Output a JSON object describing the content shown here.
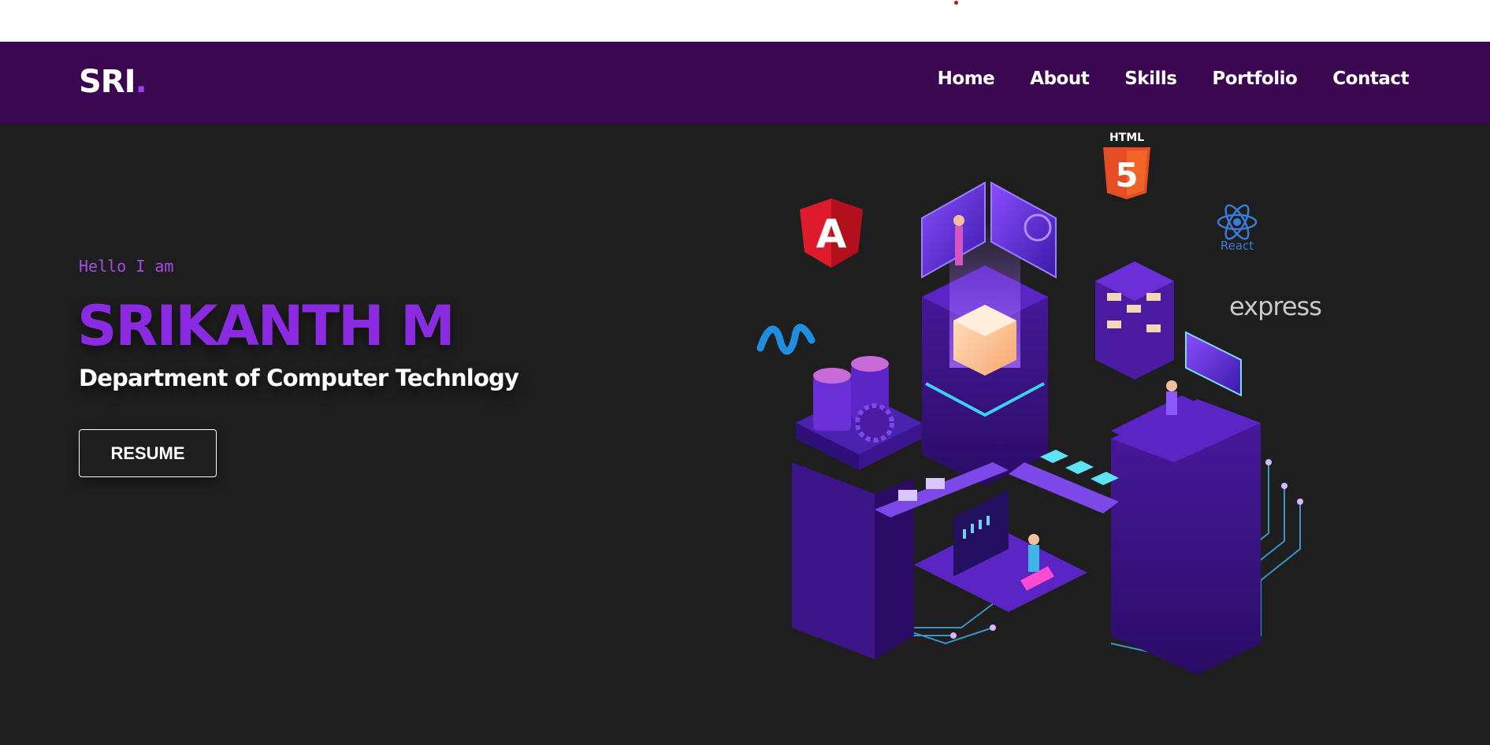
{
  "navbar": {
    "logo_text": "SRI",
    "logo_dot": ".",
    "links": [
      "Home",
      "About",
      "Skills",
      "Portfolio",
      "Contact"
    ]
  },
  "hero": {
    "greeting": "Hello I am",
    "name": "SRIKANTH M",
    "department": "Department of Computer Technlogy",
    "resume_label": "RESUME"
  },
  "illustration": {
    "html_label": "HTML",
    "html_number": "5",
    "angular_letter": "A",
    "react_label": "React",
    "express_label": "express"
  },
  "colors": {
    "navbar_bg": "#3a0750",
    "page_bg": "#1e1e1e",
    "accent": "#8a2be2",
    "greeting": "#a84be6"
  }
}
